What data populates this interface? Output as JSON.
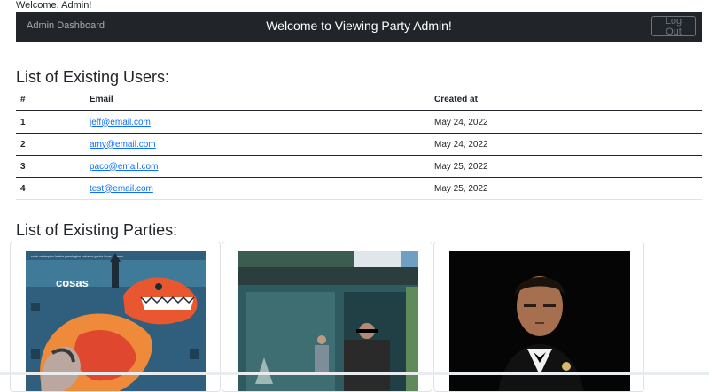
{
  "welcome": "Welcome, Admin!",
  "navbar": {
    "brand": "Admin Dashboard",
    "title": "Welcome to Viewing Party Admin!",
    "logout_label": "Log Out"
  },
  "users_section": {
    "title": "List of Existing Users:",
    "headers": [
      "#",
      "Email",
      "Created at"
    ],
    "rows": [
      {
        "num": "1",
        "email": "jeff@email.com",
        "created": "May 24, 2022"
      },
      {
        "num": "2",
        "email": "amy@email.com",
        "created": "May 24, 2022"
      },
      {
        "num": "3",
        "email": "paco@email.com",
        "created": "May 25, 2022"
      },
      {
        "num": "4",
        "email": "test@email.com",
        "created": "May 25, 2022"
      }
    ]
  },
  "parties_section": {
    "title": "List of Existing Parties:",
    "cards": [
      {
        "poster_credits": "rosie valdespino   lavinia pennington   salvador garcia   lucas moreno",
        "poster_title": "cosas"
      },
      {
        "poster_credits": "",
        "poster_title": ""
      },
      {
        "poster_credits": "",
        "poster_title": ""
      }
    ]
  },
  "colors": {
    "navbar_bg": "#212529",
    "link": "#0d6efd",
    "outline_button": "#6c757d"
  }
}
